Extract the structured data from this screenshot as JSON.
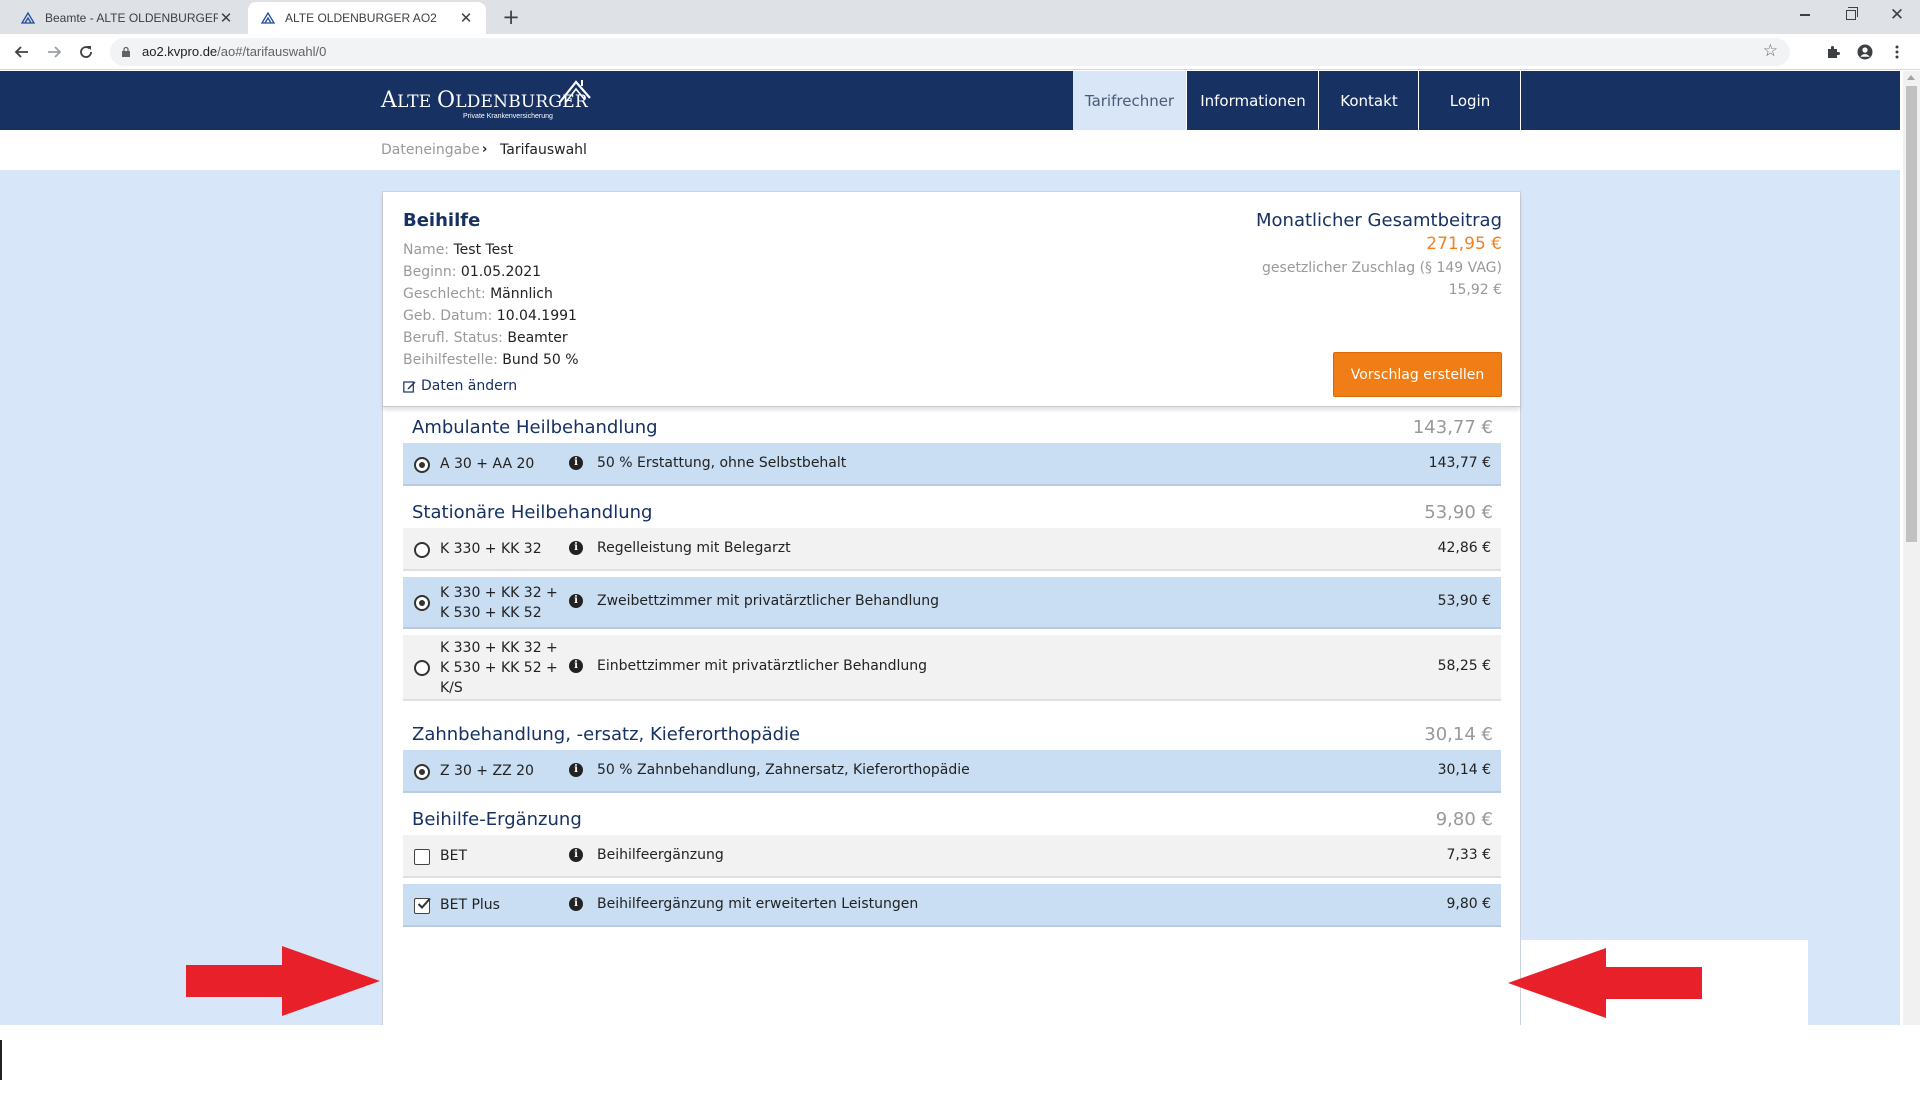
{
  "browser": {
    "tabs": [
      {
        "title": "Beamte - ALTE OLDENBURGER",
        "active": false
      },
      {
        "title": "ALTE OLDENBURGER AO2",
        "active": true
      }
    ],
    "url_host": "ao2.kvpro.de",
    "url_path": "/ao#/tarifauswahl/0"
  },
  "site": {
    "logo_line1_a": "A",
    "logo_line1_b": "LTE ",
    "logo_line1_c": "O",
    "logo_line1_d": "LDENBURGER",
    "logo_line2": "Private Krankenversicherung",
    "nav": [
      "Tarifrechner",
      "Informationen",
      "Kontakt",
      "Login"
    ]
  },
  "breadcrumb": {
    "step1": "Dateneingabe",
    "sep": "›",
    "step2": "Tarifauswahl"
  },
  "summary": {
    "title": "Beihilfe",
    "fields": [
      {
        "label": "Name:",
        "value": "Test Test"
      },
      {
        "label": "Beginn:",
        "value": "01.05.2021"
      },
      {
        "label": "Geschlecht:",
        "value": "Männlich"
      },
      {
        "label": "Geb. Datum:",
        "value": "10.04.1991"
      },
      {
        "label": "Berufl. Status:",
        "value": "Beamter"
      },
      {
        "label": "Beihilfestelle:",
        "value": "Bund 50 %"
      }
    ],
    "edit_label": "Daten ändern",
    "total_title": "Monatlicher Gesamtbeitrag",
    "total_value": "271,95 €",
    "surcharge_label": "gesetzlicher Zuschlag (§ 149 VAG)",
    "surcharge_value": "15,92 €",
    "proposal_button": "Vorschlag erstellen"
  },
  "sections": [
    {
      "title": "Ambulante Heilbehandlung",
      "price": "143,77 €",
      "rows": [
        {
          "name": [
            "A 30 + AA 20"
          ],
          "desc": "50 % Erstattung, ohne Selbstbehalt",
          "price": "143,77 €",
          "selected": true
        }
      ]
    },
    {
      "title": "Stationäre Heilbehandlung",
      "price": "53,90 €",
      "rows": [
        {
          "name": [
            "K 330 + KK 32"
          ],
          "desc": "Regelleistung mit Belegarzt",
          "price": "42,86 €",
          "selected": false
        },
        {
          "name": [
            "K 330 + KK 32 +",
            "K 530 + KK 52"
          ],
          "desc": "Zweibettzimmer mit privatärztlicher Behandlung",
          "price": "53,90 €",
          "selected": true
        },
        {
          "name": [
            "K 330 + KK 32 +",
            "K 530 + KK 52 +",
            "K/S"
          ],
          "desc": "Einbettzimmer mit privatärztlicher Behandlung",
          "price": "58,25 €",
          "selected": false
        }
      ]
    },
    {
      "title": "Zahnbehandlung, -ersatz, Kieferorthopädie",
      "price": "30,14 €",
      "rows": [
        {
          "name": [
            "Z 30 + ZZ 20"
          ],
          "desc": "50 % Zahnbehandlung, Zahnersatz, Kieferorthopädie",
          "price": "30,14 €",
          "selected": true
        }
      ]
    },
    {
      "title": "Beihilfe-Ergänzung",
      "price": "9,80 €",
      "rows": [
        {
          "name": [
            "BET"
          ],
          "desc": "Beihilfeergänzung",
          "price": "7,33 €",
          "selected": false
        },
        {
          "name": [
            "BET Plus"
          ],
          "desc": "Beihilfeergänzung mit erweiterten Leistungen",
          "price": "9,80 €",
          "selected": true
        }
      ]
    }
  ],
  "colors": {
    "brand_navy": "#173162",
    "accent_orange": "#f07d15",
    "selected_row": "#c9ddf3",
    "page_bg": "#d7e6f8",
    "annotation_arrow": "#e8202a"
  },
  "icons": {
    "info": "i",
    "edit": "edit-icon"
  }
}
